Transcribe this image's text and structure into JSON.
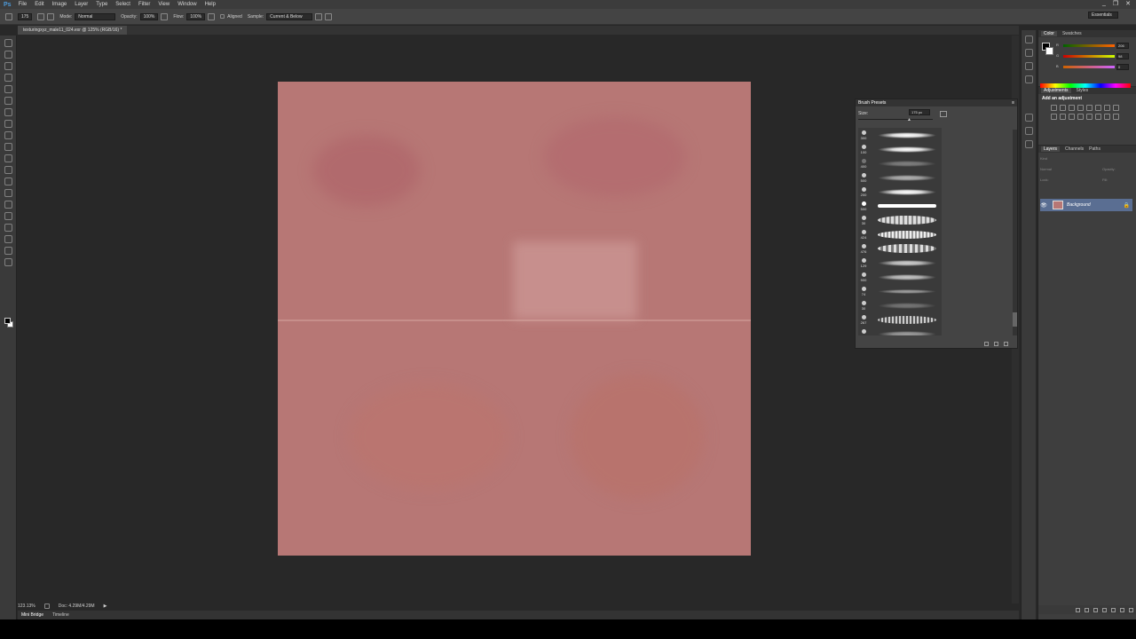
{
  "app": {
    "logo": "Ps",
    "window_controls": [
      "_",
      "❐",
      "✕"
    ]
  },
  "menu": [
    "File",
    "Edit",
    "Image",
    "Layer",
    "Type",
    "Select",
    "Filter",
    "View",
    "Window",
    "Help"
  ],
  "options_bar": {
    "brush_size": "175",
    "mode_label": "Mode:",
    "mode_value": "Normal",
    "opacity_label": "Opacity:",
    "opacity_value": "100%",
    "flow_label": "Flow:",
    "flow_value": "100%",
    "aligned_label": "Aligned",
    "sample_label": "Sample:",
    "sample_value": "Current & Below",
    "workspace": "Essentials"
  },
  "document": {
    "tab_title": "texturingxyz_male11_024.exr @ 125% (RGB/16) *",
    "zoom": "123.13%",
    "doc_info": "Doc: 4.29M/4.29M"
  },
  "bottom_tabs": [
    "Mini Bridge",
    "Timeline"
  ],
  "color_panel": {
    "tabs": [
      "Color",
      "Swatches"
    ],
    "r_label": "R",
    "g_label": "G",
    "b_label": "B",
    "r_value": "206",
    "g_value": "98",
    "b_value": "0"
  },
  "adjustments_panel": {
    "tabs": [
      "Adjustments",
      "Styles"
    ],
    "title": "Add an adjustment"
  },
  "layers_panel": {
    "tabs": [
      "Layers",
      "Channels",
      "Paths"
    ],
    "kind_label": "Kind",
    "blend_mode": "Normal",
    "opacity_label": "Opacity:",
    "lock_label": "Lock:",
    "fill_label": "Fill:",
    "layers": [
      {
        "name": "Background"
      }
    ]
  },
  "brush_presets": {
    "title": "Brush Presets",
    "size_label": "Size:",
    "size_value": "175 px",
    "brushes": [
      {
        "num": "300"
      },
      {
        "num": "100"
      },
      {
        "num": "400"
      },
      {
        "num": "500"
      },
      {
        "num": "200"
      },
      {
        "num": "500"
      },
      {
        "num": "30"
      },
      {
        "num": "424"
      },
      {
        "num": "476"
      },
      {
        "num": "129"
      },
      {
        "num": "900"
      },
      {
        "num": "74"
      },
      {
        "num": "30"
      },
      {
        "num": "267"
      },
      {
        "num": "24"
      }
    ]
  },
  "colors": {
    "canvas": "#b77775",
    "app_bg": "#282828",
    "panel_bg": "#3e3e3e",
    "layer_selected": "#5a6e92"
  }
}
